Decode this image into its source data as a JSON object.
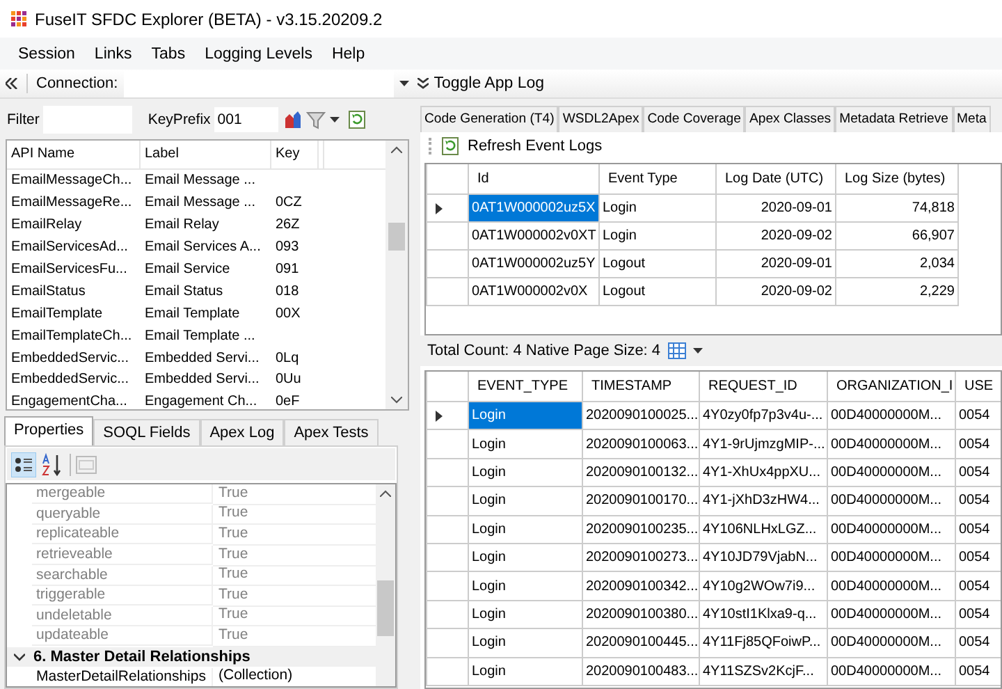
{
  "window": {
    "title": "FuseIT SFDC Explorer (BETA) - v3.15.20209.2"
  },
  "menu": [
    "Session",
    "Links",
    "Tabs",
    "Logging Levels",
    "Help"
  ],
  "connection_bar": {
    "label": "Connection:",
    "toggle": "Toggle App Log"
  },
  "filter": {
    "label": "Filter",
    "key_prefix_label": "KeyPrefix",
    "key_prefix": "001"
  },
  "objects": {
    "columns": [
      "API Name",
      "Label",
      "Key"
    ],
    "rows": [
      {
        "api_name": "EmailMessageCh...",
        "label": "Email Message ..."
      },
      {
        "api_name": "EmailMessageRe...",
        "label": "Email Message ...",
        "key": "0CZ"
      },
      {
        "api_name": "EmailRelay",
        "label": "Email Relay",
        "key": "26Z"
      },
      {
        "api_name": "EmailServicesAd...",
        "label": "Email Services A...",
        "key": "093"
      },
      {
        "api_name": "EmailServicesFu...",
        "label": "Email Service",
        "key": "091"
      },
      {
        "api_name": "EmailStatus",
        "label": "Email Status",
        "key": "018"
      },
      {
        "api_name": "EmailTemplate",
        "label": "Email Template",
        "key": "00X"
      },
      {
        "api_name": "EmailTemplateCh...",
        "label": "Email Template ..."
      },
      {
        "api_name": "EmbeddedServic...",
        "label": "Embedded Servi...",
        "key": "0Lq"
      },
      {
        "api_name": "EmbeddedServic...",
        "label": "Embedded Servi...",
        "key": "0Uu"
      },
      {
        "api_name": "EngagementCha...",
        "label": "Engagement Ch...",
        "key": "0eF"
      }
    ]
  },
  "left_tabs": [
    {
      "label": "Properties",
      "selected": true
    },
    {
      "label": "SOQL Fields",
      "selected": false
    },
    {
      "label": "Apex Log",
      "selected": false
    },
    {
      "label": "Apex Tests",
      "selected": false
    }
  ],
  "properties": [
    {
      "kind": "row",
      "name": "mergeable",
      "value": "True"
    },
    {
      "kind": "row",
      "name": "queryable",
      "value": "True"
    },
    {
      "kind": "row",
      "name": "replicateable",
      "value": "True"
    },
    {
      "kind": "row",
      "name": "retrieveable",
      "value": "True"
    },
    {
      "kind": "row",
      "name": "searchable",
      "value": "True"
    },
    {
      "kind": "row",
      "name": "triggerable",
      "value": "True"
    },
    {
      "kind": "row",
      "name": "undeletable",
      "value": "True"
    },
    {
      "kind": "row",
      "name": "updateable",
      "value": "True"
    },
    {
      "kind": "category",
      "label": "6. Master Detail Relationships",
      "expanded": true,
      "children": [
        {
          "name": "MasterDetailRelationships",
          "value": "(Collection)"
        }
      ]
    }
  ],
  "right_tabs": [
    {
      "label": "Code Generation (T4)",
      "selected": false
    },
    {
      "label": "WSDL2Apex",
      "selected": false
    },
    {
      "label": "Code Coverage",
      "selected": false
    },
    {
      "label": "Apex Classes",
      "selected": false
    },
    {
      "label": "Metadata Retrieve",
      "selected": false
    },
    {
      "label": "Meta",
      "selected": false
    }
  ],
  "event_logs": {
    "refresh": "Refresh Event Logs",
    "columns": [
      "Id",
      "Event Type",
      "Log Date (UTC)",
      "Log Size (bytes)"
    ],
    "rows": [
      {
        "selected": true,
        "cells": [
          "0AT1W000002uz5X",
          "Login",
          "2020-09-01",
          "74,818"
        ]
      },
      {
        "selected": false,
        "cells": [
          "0AT1W000002v0XT",
          "Login",
          "2020-09-02",
          "66,907"
        ]
      },
      {
        "selected": false,
        "cells": [
          "0AT1W000002uz5Y",
          "Logout",
          "2020-09-01",
          "2,034"
        ]
      },
      {
        "selected": false,
        "cells": [
          "0AT1W000002v0X",
          "Logout",
          "2020-09-02",
          "2,229"
        ]
      }
    ]
  },
  "status": "Total Count: 4 Native Page Size: 4",
  "log_detail": {
    "columns": [
      "EVENT_TYPE",
      "TIMESTAMP",
      "REQUEST_ID",
      "ORGANIZATION_I",
      "USE"
    ],
    "rows": [
      {
        "selected": true,
        "cells": [
          "Login",
          "2020090100025...",
          "4Y0zy0fp7p3v4u-...",
          "00D40000000M...",
          "0054"
        ]
      },
      {
        "selected": false,
        "cells": [
          "Login",
          "2020090100063...",
          "4Y1-9rUjmzgMIP-...",
          "00D40000000M...",
          "0054"
        ]
      },
      {
        "selected": false,
        "cells": [
          "Login",
          "2020090100132...",
          "4Y1-XhUx4ppXU...",
          "00D40000000M...",
          "0054"
        ]
      },
      {
        "selected": false,
        "cells": [
          "Login",
          "2020090100170...",
          "4Y1-jXhD3zHW4...",
          "00D40000000M...",
          "0054"
        ]
      },
      {
        "selected": false,
        "cells": [
          "Login",
          "2020090100235...",
          "4Y106NLHxLGZ...",
          "00D40000000M...",
          "0054"
        ]
      },
      {
        "selected": false,
        "cells": [
          "Login",
          "2020090100273...",
          "4Y10JD79VjabN...",
          "00D40000000M...",
          "0054"
        ]
      },
      {
        "selected": false,
        "cells": [
          "Login",
          "2020090100342...",
          "4Y10g2WOw7i9...",
          "00D40000000M...",
          "0054"
        ]
      },
      {
        "selected": false,
        "cells": [
          "Login",
          "2020090100380...",
          "4Y10stI1Klxa9-q...",
          "00D40000000M...",
          "0054"
        ]
      },
      {
        "selected": false,
        "cells": [
          "Login",
          "2020090100445...",
          "4Y11Fj85QFoiwP...",
          "00D40000000M...",
          "0054"
        ]
      },
      {
        "selected": false,
        "cells": [
          "Login",
          "2020090100483...",
          "4Y11SZSv2KcjF...",
          "00D40000000M...",
          "0054"
        ]
      }
    ]
  }
}
